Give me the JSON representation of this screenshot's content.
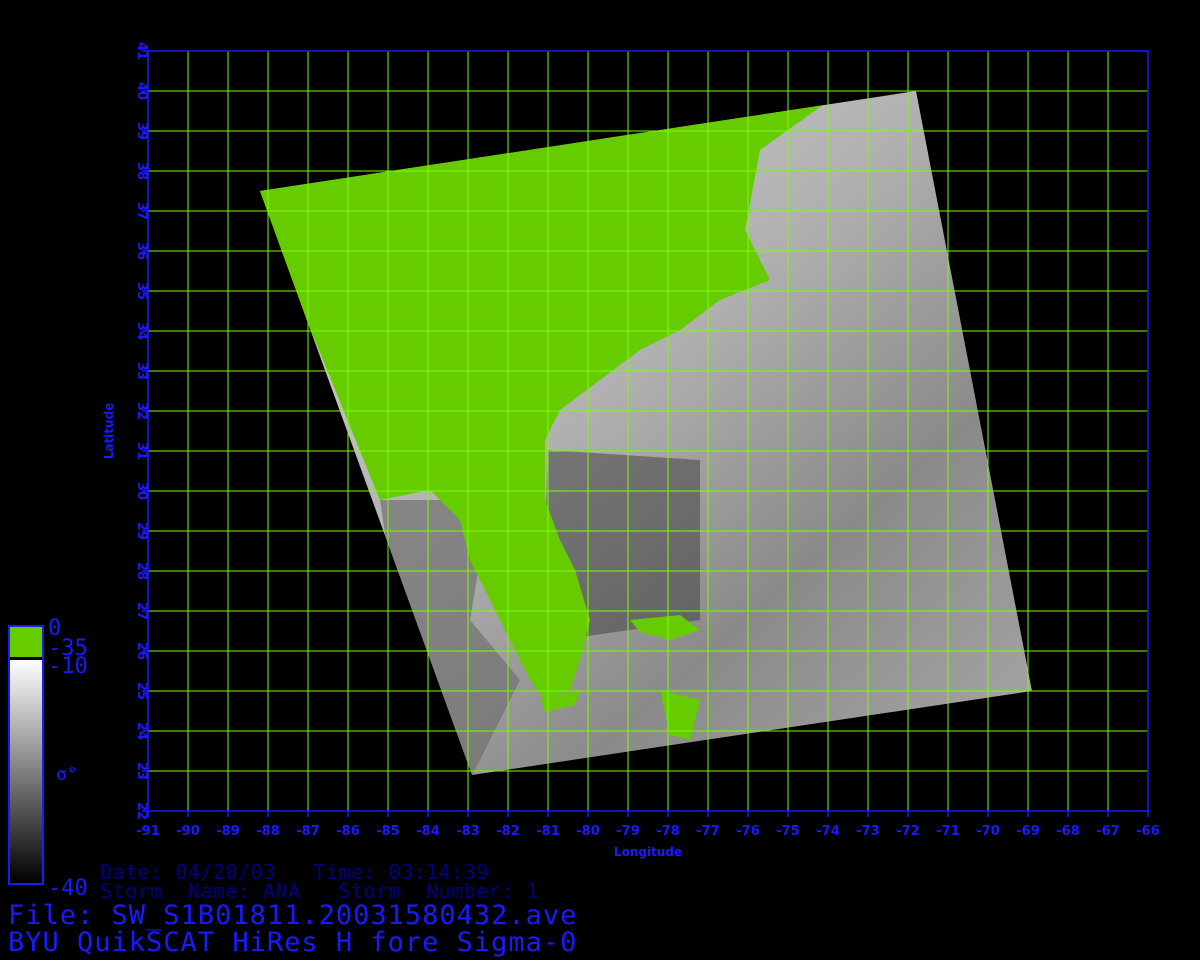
{
  "colors": {
    "grid": "#7cfc00",
    "axis": "#1a1aff",
    "land": "#66cc00",
    "background": "#000000",
    "info_text": "#000080"
  },
  "axes": {
    "x_label": "Longitude",
    "y_label": "Latitude",
    "lon_range": [
      -91,
      -66
    ],
    "lat_range": [
      22,
      41
    ],
    "lon_ticks": [
      -91,
      -90,
      -89,
      -88,
      -87,
      -86,
      -85,
      -84,
      -83,
      -82,
      -81,
      -80,
      -79,
      -78,
      -77,
      -76,
      -75,
      -74,
      -73,
      -72,
      -71,
      -70,
      -69,
      -68,
      -67,
      -66
    ],
    "lat_ticks": [
      22,
      23,
      24,
      25,
      26,
      27,
      28,
      29,
      30,
      31,
      32,
      33,
      34,
      35,
      36,
      37,
      38,
      39,
      40,
      41
    ]
  },
  "swath": {
    "corners_lonlat": [
      [
        -88.2,
        37.5
      ],
      [
        -71.8,
        40.0
      ],
      [
        -68.9,
        25.0
      ],
      [
        -82.9,
        22.9
      ]
    ]
  },
  "colorbar": {
    "land_top": "0",
    "land_bottom": "-35",
    "scale_top": "-10",
    "scale_label": "σ°",
    "scale_bottom": "-40"
  },
  "info": {
    "line1": "Date: 04/20/03   Time: 03:14:39",
    "line2": "Storm  Name: ANA   Storm  Number: 1"
  },
  "title": {
    "file": "File: SW_S1B01811.20031580432.ave",
    "product": "BYU QuikSCAT HiRes H fore Sigma-0"
  }
}
